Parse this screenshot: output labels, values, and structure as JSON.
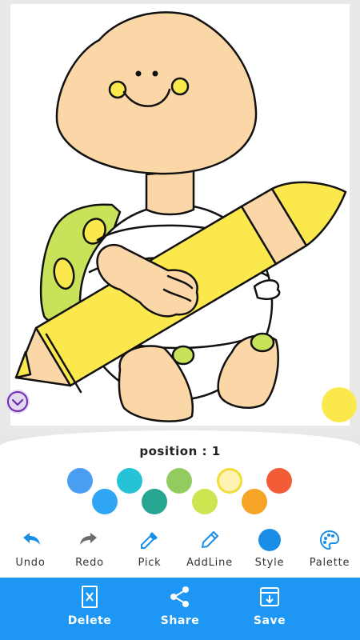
{
  "position": {
    "label": "position : 1"
  },
  "palette": {
    "colors": [
      {
        "hex": "#4a9ef2"
      },
      {
        "hex": "#2fa6f3"
      },
      {
        "hex": "#26c2d8"
      },
      {
        "hex": "#26a591"
      },
      {
        "hex": "#92cc60"
      },
      {
        "hex": "#cfe451"
      },
      {
        "hex": "#fff3b4"
      },
      {
        "hex": "#f6a425"
      },
      {
        "hex": "#f45b37"
      }
    ],
    "selected_index": 6
  },
  "current_color": "#fbe84d",
  "tools": [
    {
      "label": "Undo",
      "icon": "undo-icon"
    },
    {
      "label": "Redo",
      "icon": "redo-icon"
    },
    {
      "label": "Pick",
      "icon": "eyedropper-icon"
    },
    {
      "label": "AddLine",
      "icon": "pencil-icon"
    },
    {
      "label": "Style",
      "icon": "circle-icon"
    },
    {
      "label": "Palette",
      "icon": "palette-icon"
    }
  ],
  "actions": [
    {
      "label": "Delete",
      "icon": "delete-icon"
    },
    {
      "label": "Share",
      "icon": "share-icon"
    },
    {
      "label": "Save",
      "icon": "save-icon"
    }
  ],
  "theme": {
    "accent": "#1e96f3",
    "icon_blue": "#1a8ee6"
  }
}
